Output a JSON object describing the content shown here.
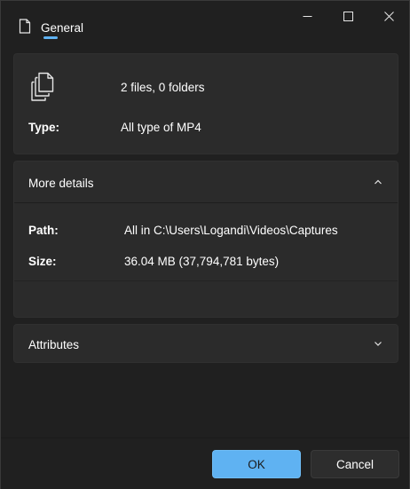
{
  "window": {
    "tab_label": "General",
    "tab_icon": "document-icon",
    "controls": [
      "minimize-icon",
      "maximize-icon",
      "close-icon"
    ]
  },
  "summary": {
    "icon": "multiple-files-icon",
    "contents": "2 files, 0 folders",
    "type_label": "Type:",
    "type_value": "All type of MP4"
  },
  "more_details": {
    "title": "More details",
    "path_label": "Path:",
    "path_value": "All in C:\\Users\\Logandi\\Videos\\Captures",
    "size_label": "Size:",
    "size_value": "36.04 MB (37,794,781 bytes)",
    "expanded": true
  },
  "attributes": {
    "title": "Attributes",
    "expanded": false
  },
  "footer": {
    "ok_label": "OK",
    "cancel_label": "Cancel"
  },
  "colors": {
    "accent": "#5fb2f2",
    "background": "#202020",
    "card": "#2b2b2b"
  }
}
